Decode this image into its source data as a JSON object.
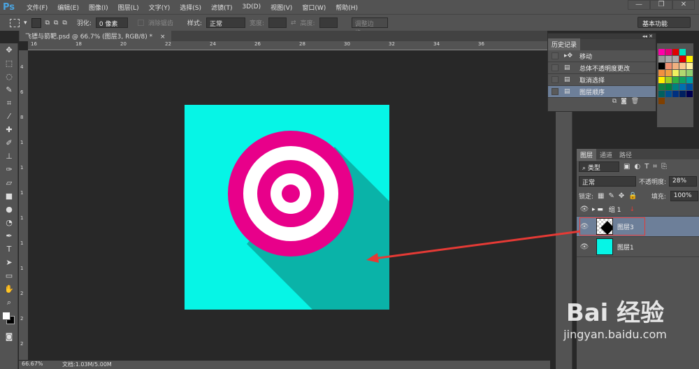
{
  "app": {
    "logo": "Ps"
  },
  "menu": [
    "文件(F)",
    "编辑(E)",
    "图像(I)",
    "图层(L)",
    "文字(Y)",
    "选择(S)",
    "滤镜(T)",
    "3D(D)",
    "视图(V)",
    "窗口(W)",
    "帮助(H)"
  ],
  "window_buttons": [
    "—",
    "❐",
    "✕"
  ],
  "options": {
    "feather_label": "羽化:",
    "feather_value": "0 像素",
    "antialias": "消除锯齿",
    "style_label": "样式:",
    "style_value": "正常",
    "width_label": "宽度:",
    "height_label": "高度:",
    "refine_edge": "调整边缘...",
    "workspace": "基本功能"
  },
  "document": {
    "tab": "飞镖与箭靶.psd @ 66.7% (图层3, RGB/8) *",
    "close": "×"
  },
  "ruler": {
    "h": [
      "16",
      "18",
      "20",
      "22",
      "24",
      "26",
      "28",
      "30",
      "32",
      "34",
      "36"
    ],
    "v": [
      "4",
      "6",
      "8",
      "1",
      "1",
      "1",
      "1",
      "1",
      "1",
      "2",
      "2",
      "2"
    ]
  },
  "status": {
    "zoom": "66.67%",
    "doc": "文档:1.03M/5.00M"
  },
  "history": {
    "title": "历史记录",
    "items": [
      {
        "label": "移动",
        "icon": "move"
      },
      {
        "label": "总体不透明度更改",
        "icon": "doc"
      },
      {
        "label": "取消选择",
        "icon": "doc"
      },
      {
        "label": "图层顺序",
        "icon": "doc",
        "selected": true
      }
    ]
  },
  "layers": {
    "tabs": [
      "图层",
      "通道",
      "路径"
    ],
    "filter": "类型",
    "blend": "正常",
    "opacity_label": "不透明度:",
    "opacity": "28%",
    "lock_label": "锁定:",
    "fill_label": "填充:",
    "fill": "100%",
    "items": [
      {
        "name": "组 1",
        "type": "group"
      },
      {
        "name": "图层3",
        "selected": true
      },
      {
        "name": "图层1"
      }
    ]
  },
  "watermark": {
    "brand": "Bai 经验",
    "url": "jingyan.baidu.com"
  },
  "colors": {
    "cyan": "#06f5e6",
    "shadow": "#0ab3a8",
    "magenta": "#e8008a",
    "arrow": "#e53a35"
  }
}
